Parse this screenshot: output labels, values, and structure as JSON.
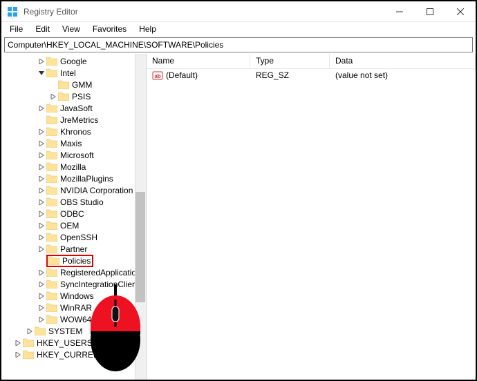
{
  "window": {
    "title": "Registry Editor"
  },
  "menu": {
    "file": "File",
    "edit": "Edit",
    "view": "View",
    "favorites": "Favorites",
    "help": "Help"
  },
  "address": "Computer\\HKEY_LOCAL_MACHINE\\SOFTWARE\\Policies",
  "tree": {
    "items": [
      {
        "level": 3,
        "exp": ">",
        "name": "Google"
      },
      {
        "level": 3,
        "exp": "v",
        "name": "Intel"
      },
      {
        "level": 4,
        "exp": "",
        "name": "GMM"
      },
      {
        "level": 4,
        "exp": ">",
        "name": "PSIS"
      },
      {
        "level": 3,
        "exp": ">",
        "name": "JavaSoft"
      },
      {
        "level": 3,
        "exp": "",
        "name": "JreMetrics"
      },
      {
        "level": 3,
        "exp": ">",
        "name": "Khronos"
      },
      {
        "level": 3,
        "exp": ">",
        "name": "Maxis"
      },
      {
        "level": 3,
        "exp": ">",
        "name": "Microsoft"
      },
      {
        "level": 3,
        "exp": ">",
        "name": "Mozilla"
      },
      {
        "level": 3,
        "exp": ">",
        "name": "MozillaPlugins"
      },
      {
        "level": 3,
        "exp": ">",
        "name": "NVIDIA Corporation"
      },
      {
        "level": 3,
        "exp": ">",
        "name": "OBS Studio"
      },
      {
        "level": 3,
        "exp": ">",
        "name": "ODBC"
      },
      {
        "level": 3,
        "exp": ">",
        "name": "OEM"
      },
      {
        "level": 3,
        "exp": ">",
        "name": "OpenSSH"
      },
      {
        "level": 3,
        "exp": ">",
        "name": "Partner"
      },
      {
        "level": 3,
        "exp": "",
        "name": "Policies",
        "highlight": true
      },
      {
        "level": 3,
        "exp": ">",
        "name": "RegisteredApplications"
      },
      {
        "level": 3,
        "exp": ">",
        "name": "SyncIntegrationClient"
      },
      {
        "level": 3,
        "exp": ">",
        "name": "Windows"
      },
      {
        "level": 3,
        "exp": ">",
        "name": "WinRAR"
      },
      {
        "level": 3,
        "exp": ">",
        "name": "WOW6432Node"
      },
      {
        "level": 2,
        "exp": ">",
        "name": "SYSTEM"
      },
      {
        "level": 1,
        "exp": ">",
        "name": "HKEY_USERS"
      },
      {
        "level": 1,
        "exp": ">",
        "name": "HKEY_CURRENT_CONFIG"
      }
    ]
  },
  "list": {
    "headers": {
      "name": "Name",
      "type": "Type",
      "data": "Data"
    },
    "rows": [
      {
        "name": "(Default)",
        "type": "REG_SZ",
        "data": "(value not set)"
      }
    ]
  }
}
